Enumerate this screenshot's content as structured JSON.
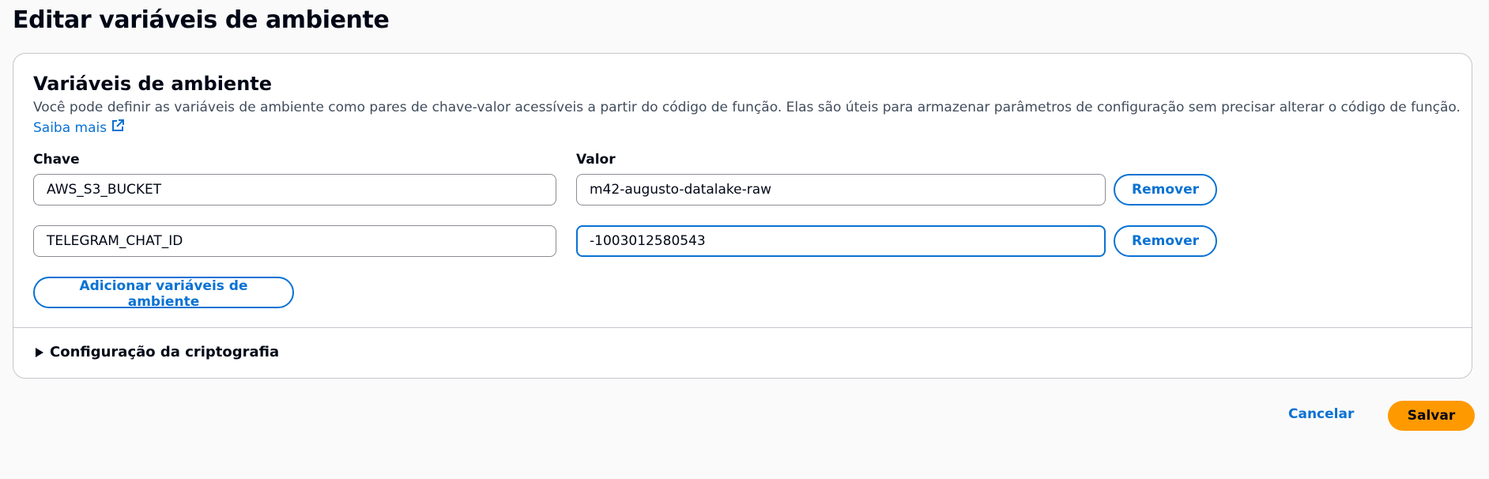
{
  "page": {
    "title": "Editar variáveis de ambiente"
  },
  "env_section": {
    "title": "Variáveis de ambiente",
    "description": "Você pode definir as variáveis de ambiente como pares de chave-valor acessíveis a partir do código de função. Elas são úteis para armazenar parâmetros de configuração sem precisar alterar o código de função.",
    "learn_more": "Saiba mais",
    "key_label": "Chave",
    "value_label": "Valor",
    "rows": [
      {
        "key": "AWS_S3_BUCKET",
        "value": "m42-augusto-datalake-raw",
        "remove_label": "Remover"
      },
      {
        "key": "TELEGRAM_CHAT_ID",
        "value": "-1003012580543",
        "remove_label": "Remover"
      }
    ],
    "add_label": "Adicionar variáveis de ambiente"
  },
  "encryption": {
    "label": "Configuração da criptografia"
  },
  "footer": {
    "cancel_label": "Cancelar",
    "save_label": "Salvar"
  },
  "colors": {
    "link": "#0972d3",
    "primary_button": "#ff9900",
    "border": "#c6c6cd"
  }
}
